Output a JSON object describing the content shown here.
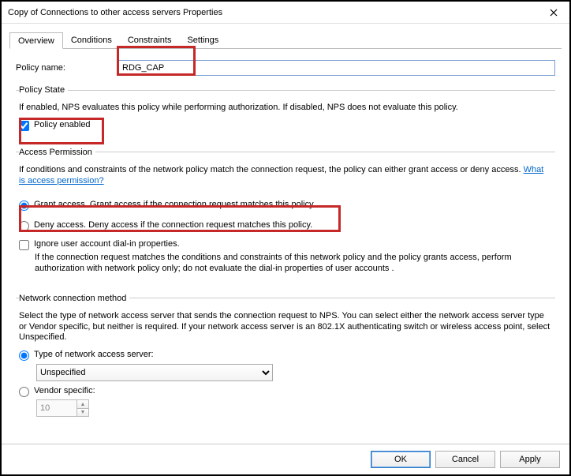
{
  "window": {
    "title": "Copy of Connections to other access servers Properties"
  },
  "tabs": [
    "Overview",
    "Conditions",
    "Constraints",
    "Settings"
  ],
  "policy_name": {
    "label": "Policy name:",
    "value": "RDG_CAP"
  },
  "policy_state": {
    "legend": "Policy State",
    "desc": "If enabled, NPS evaluates this policy while performing authorization. If disabled, NPS does not evaluate this policy.",
    "enabled_label": "Policy enabled"
  },
  "access_permission": {
    "legend": "Access Permission",
    "desc_prefix": "If conditions and constraints of the network policy match the connection request, the policy can either grant access or deny access. ",
    "link": "What is access permission?",
    "grant_label": "Grant access. Grant access if the connection request matches this policy.",
    "deny_label": "Deny access. Deny access if the connection request matches this policy.",
    "ignore_label": "Ignore user account dial-in properties.",
    "ignore_desc": "If the connection request matches the conditions and constraints of this network policy and the policy grants access, perform authorization with network policy only; do not evaluate the dial-in properties of user accounts ."
  },
  "ncm": {
    "legend": "Network connection method",
    "desc": "Select the type of network access server that sends the connection request to NPS. You can select either the network access server type or Vendor specific, but neither is required.  If your network access server is an 802.1X authenticating switch or wireless access point, select Unspecified.",
    "type_label": "Type of network access server:",
    "type_value": "Unspecified",
    "vendor_label": "Vendor specific:",
    "vendor_value": "10"
  },
  "buttons": {
    "ok": "OK",
    "cancel": "Cancel",
    "apply": "Apply"
  }
}
